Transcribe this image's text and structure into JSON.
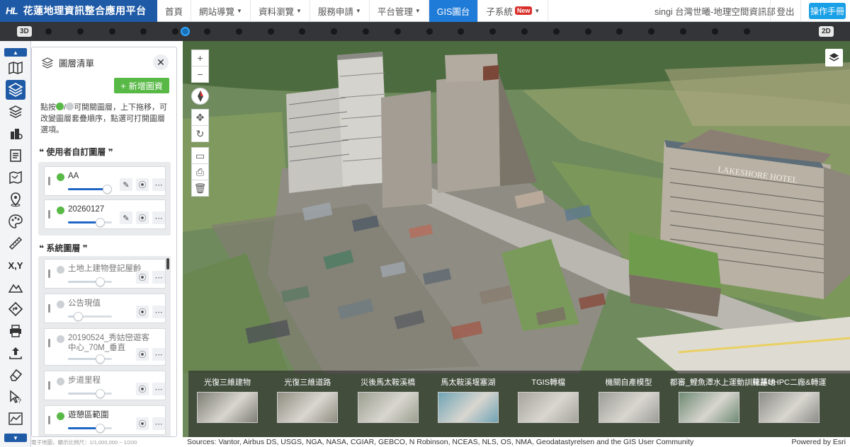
{
  "header": {
    "logo_mark": "HL",
    "logo_title": "花蓮地理資訊整合應用平台",
    "nav": [
      {
        "label": "首頁",
        "has_caret": false,
        "active": false
      },
      {
        "label": "網站導覽",
        "has_caret": true,
        "active": false
      },
      {
        "label": "資料瀏覽",
        "has_caret": true,
        "active": false
      },
      {
        "label": "服務申請",
        "has_caret": true,
        "active": false
      },
      {
        "label": "平台管理",
        "has_caret": true,
        "active": false
      },
      {
        "label": "GIS圖台",
        "has_caret": false,
        "active": true
      },
      {
        "label": "子系統",
        "has_caret": true,
        "active": false,
        "badge": "New"
      }
    ],
    "user": "singi 台灣世曦-地理空間資訊部",
    "logout": "登出",
    "manual": "操作手冊"
  },
  "timeline": {
    "left_mode": "3D",
    "right_mode": "2D"
  },
  "sidebar": {
    "icons": [
      "map-icon",
      "layers-icon",
      "layer-stack-icon",
      "buildings-3d-icon",
      "document-icon",
      "map-fold-icon",
      "location-pin-icon",
      "palette-icon",
      "ruler-icon",
      "xy-coordinate-icon",
      "terrain-icon",
      "route-icon",
      "print-icon",
      "upload-icon",
      "eraser-icon",
      "query-cursor-icon",
      "profile-chart-icon"
    ],
    "xy_label": "X,Y",
    "footnote": "電子地圖，顯示比例尺：1/1,000,000 ~ 1/200"
  },
  "panel": {
    "title": "圖層清單",
    "close": "✕",
    "add_button": "新增圖資",
    "help_a": "點按",
    "help_b": "/",
    "help_c": "可開關圖層，上下拖移，可改變圖層套疊順序，點選可打開圖層選項。",
    "user_section": "❝ 使用者自訂圖層 ❞",
    "system_section": "❝ 系統圖層 ❞",
    "user_layers": [
      {
        "name": "AA",
        "opacity": 0.88,
        "on": true
      },
      {
        "name": "20260127",
        "opacity": 0.72,
        "on": true
      }
    ],
    "system_layers": [
      {
        "name": "土地上建物登記屋齡",
        "opacity": 0.73,
        "on": false
      },
      {
        "name": "公告現值",
        "opacity": 0.22,
        "on": false
      },
      {
        "name": "20190524_秀姑巒遊客中心_70M_垂直",
        "opacity": 0.73,
        "on": false
      },
      {
        "name": "步道里程",
        "opacity": 0.73,
        "on": false
      },
      {
        "name": "遊憩區範圍",
        "opacity": 0.73,
        "on": true
      }
    ]
  },
  "map": {
    "hotel_sign": "LAKESHORE HOTEL",
    "thumbnails": [
      "光復三維建物",
      "光復三維道路",
      "災後馬太鞍溪橋",
      "馬太鞍溪堰塞湖",
      "TGIS轉檔",
      "機關自產模型",
      "都審_鯉魚潭水上運動訓練基地",
      "花蓮UHPC二廠&轉運"
    ],
    "attribution": "Sources: Vantor, Airbus DS, USGS, NGA, NASA, CGIAR, GEBCO, N Robinson, NCEAS, NLS, OS, NMA, Geodatastyrelsen and the GIS User Community",
    "powered_by": "Powered by Esri"
  },
  "colors": {
    "brand": "#1f5aa6",
    "active_tab": "#1f7bd8",
    "add_green": "#59b947",
    "manual_blue": "#19a0e6",
    "new_badge": "#d9302c"
  }
}
